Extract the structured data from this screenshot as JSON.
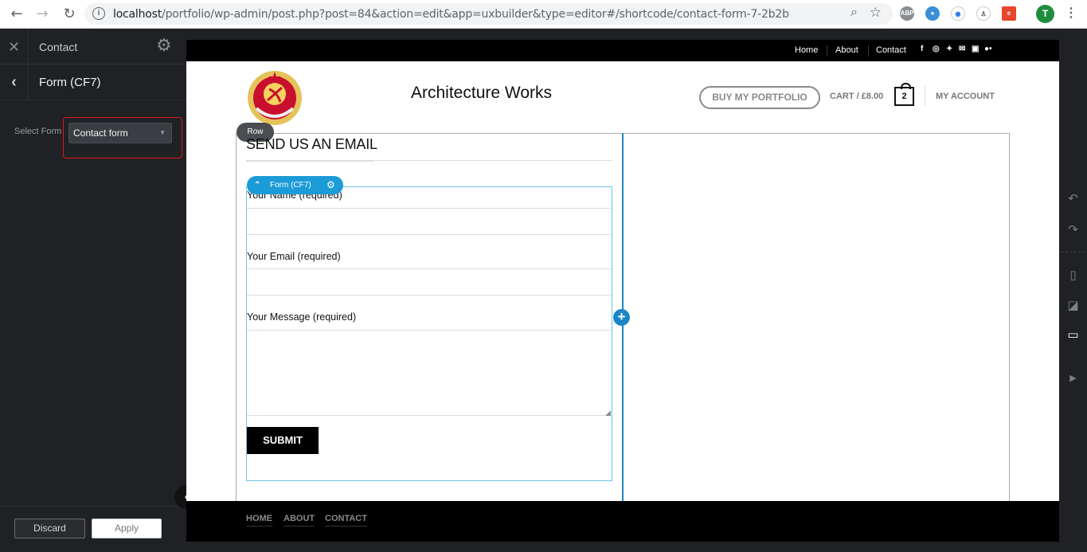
{
  "browser": {
    "url_host": "localhost",
    "url_path": "/portfolio/wp-admin/post.php?post=84&action=edit&app=uxbuilder&type=editor#/shortcode/contact-form-7-2b2b",
    "profile_initial": "T",
    "extensions": [
      "ABP",
      "e"
    ]
  },
  "sidebar": {
    "title": "Contact",
    "subtitle": "Form (CF7)",
    "select_label": "Select Form",
    "select_value": "Contact form",
    "discard_label": "Discard",
    "apply_label": "Apply"
  },
  "site": {
    "topnav": [
      "Home",
      "About",
      "Contact"
    ],
    "title": "Architecture Works",
    "portfolio_button": "BUY MY PORTFOLIO",
    "cart_text": "CART / £8.00",
    "cart_count": "2",
    "account": "MY ACCOUNT",
    "row_badge": "Row",
    "heading": "SEND US AN EMAIL",
    "form_badge": "Form (CF7)",
    "fields": [
      "Your Name (required)",
      "Your Email (required)",
      "Your Message (required)"
    ],
    "submit": "SUBMIT",
    "footer_links": [
      "HOME",
      "ABOUT",
      "CONTACT"
    ]
  },
  "colors": {
    "accent_blue": "#1b9bd7",
    "column_blue": "#1b86c7",
    "highlight_red": "#e0141e",
    "sidebar_bg": "#1f2124"
  },
  "icons": {
    "social": [
      "facebook-icon",
      "instagram-icon",
      "twitter-icon",
      "email-icon",
      "linkedin-icon",
      "flickr-icon"
    ],
    "right_tools": [
      "undo-icon",
      "redo-icon",
      "mobile-icon",
      "tablet-icon",
      "desktop-icon",
      "play-icon"
    ]
  }
}
